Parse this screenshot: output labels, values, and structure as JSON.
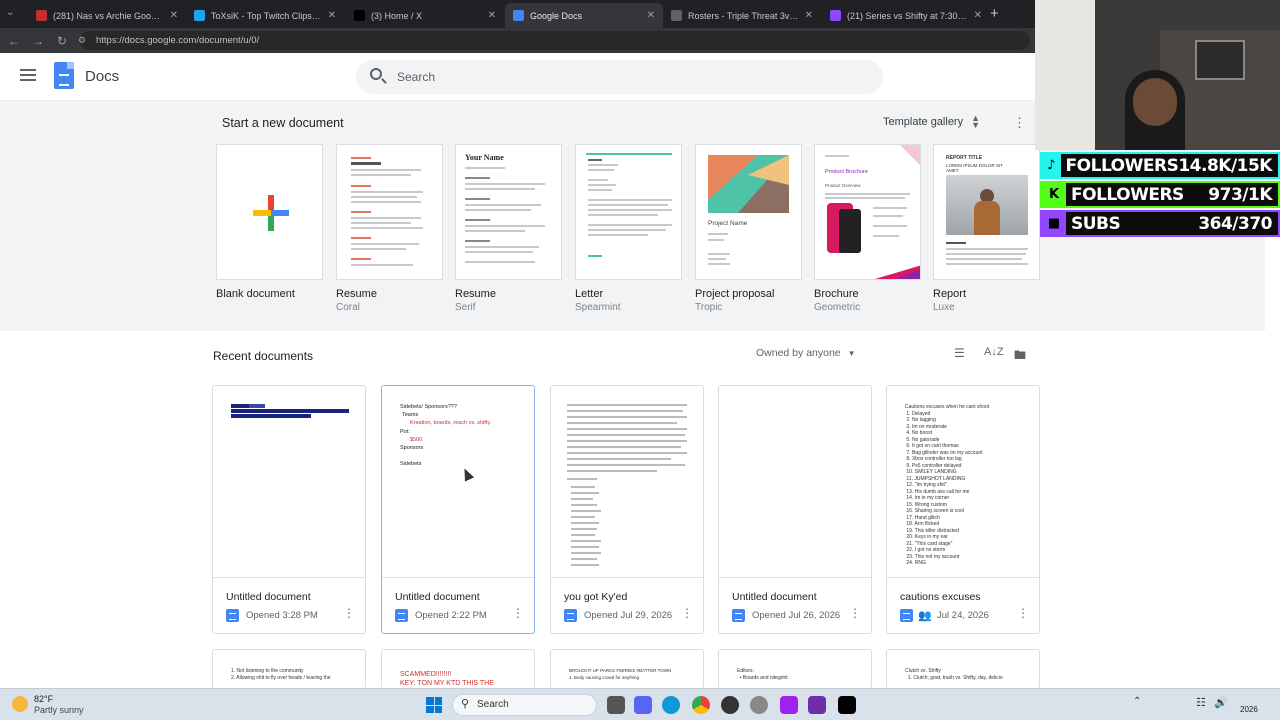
{
  "browser": {
    "tabs": [
      {
        "title": "(281) Nas vs Archie Goodwin 1v1...",
        "color": "#c4302b",
        "active": false
      },
      {
        "title": "ToXsiK - Top Twitch Clips - TwitchTr...",
        "color": "#1da1f2",
        "active": false
      },
      {
        "title": "(3) Home / X",
        "color": "#000000",
        "active": false
      },
      {
        "title": "Google Docs",
        "color": "#4285f4",
        "active": true
      },
      {
        "title": "Rosters - Triple Threat 3v3 | Check...",
        "color": "#5f6368",
        "active": false
      },
      {
        "title": "(21) Series vs Shifty at 7:30! BOSTO...",
        "color": "#9146ff",
        "active": false
      }
    ],
    "new_tab": "+",
    "url": "https://docs.google.com/document/u/0/"
  },
  "docs": {
    "app_name": "Docs",
    "search_placeholder": "Search"
  },
  "templates": {
    "heading": "Start a new document",
    "gallery_label": "Template gallery",
    "items": [
      {
        "name": "Blank document",
        "sub": ""
      },
      {
        "name": "Resume",
        "sub": "Coral"
      },
      {
        "name": "Resume",
        "sub": "Serif"
      },
      {
        "name": "Letter",
        "sub": "Spearmint"
      },
      {
        "name": "Project proposal",
        "sub": "Tropic"
      },
      {
        "name": "Brochure",
        "sub": "Geometric"
      },
      {
        "name": "Report",
        "sub": "Luxe"
      }
    ],
    "thumb_text": {
      "serif_name": "Your Name",
      "project_name": "Project Name",
      "brochure_title": "Product Brochure",
      "brochure_overview": "Product Overview",
      "report_title": "REPORT TITLE",
      "report_sub": "LOREM IPSUM DOLOR SIT AMET"
    }
  },
  "recent": {
    "heading": "Recent documents",
    "owner_filter": "Owned by anyone",
    "docs": [
      {
        "title": "Untitled document",
        "meta": "Opened 3:28 PM",
        "shared": false
      },
      {
        "title": "Untitled document",
        "meta": "Opened 2:22 PM",
        "shared": false
      },
      {
        "title": "you got Ky'ed",
        "meta": "Opened Jul 29, 2026",
        "shared": false
      },
      {
        "title": "Untitled document",
        "meta": "Opened Jul 26, 2026",
        "shared": false
      },
      {
        "title": "cautions excuses",
        "meta": "Jul 24, 2026",
        "shared": true
      }
    ],
    "preview2": {
      "line1": "Sidebets/ Sponsors???",
      "line2": "Teams",
      "line3": "Kreation, boards, reach vs. shifty.",
      "line4": "Pot:",
      "line5": "$500",
      "line6": "Sponsors",
      "line7": "Sidebets"
    },
    "preview5": {
      "lines": "Cautions excuses when he cant shoot\n 1. Delayed\n 2. No lagging\n 3. Im on moderate\n 4. No boost\n 5. No gatorade\n 6. It got on cant thomas\n 7. Bag gilinder was on my account\n 8. Xbox controller too lag\n 9. Ps5 controller delayed\n 10. SMILEY LANDING\n 11. JUMPSHOT LANDING\n 12. \"Im trying shit\"\n 13. His dumb ass call for me\n 14. Im in my corner\n 15. Wrong custom\n 16. Sharing screen is cool\n 17. Hand glitch\n 18. Arm flicked\n 19. This killer distracted\n 20. Keys in my ear\n 21. \"This card stage\"\n 22. I got no storm\n 23. This not my account\n 24. RNG"
    },
    "row2": [
      {
        "text": "1. Not listening to the community\n2. Allowing shit to fly over heads / leaving the"
      },
      {
        "text": "SCAMMED!!!!!!!!\nKEY: TON MY KTD THIS THE"
      },
      {
        "text": "BROUGHT UP PARKS #SERIES #BATTER TOWN\n1. Body causing crowd for anything"
      },
      {
        "text": "Editors:\n  • Boards and nitegrint"
      },
      {
        "text": "Clutch vs. Shifty\n  1. Clutch, goat, trash vs. Shifty, day, delicio"
      }
    ]
  },
  "stream": {
    "stats": [
      {
        "label": "FOLLOWERS",
        "value": "14.8K/15K",
        "color": "#25f4ee",
        "icon": "tiktok-icon"
      },
      {
        "label": "FOLLOWERS",
        "value": "973/1K",
        "color": "#53fc18",
        "icon": "kick-icon"
      },
      {
        "label": "SUBS",
        "value": "364/370",
        "color": "#9146ff",
        "icon": "twitch-icon"
      }
    ]
  },
  "taskbar": {
    "weather_temp": "82°F",
    "weather_desc": "Partly sunny",
    "search_label": "Search",
    "clock_time": "",
    "clock_date": "2026"
  }
}
